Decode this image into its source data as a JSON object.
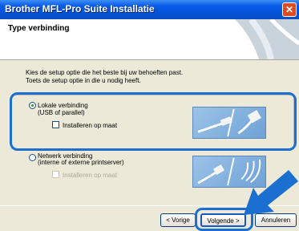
{
  "window": {
    "title": "Brother MFL-Pro Suite Installatie",
    "close_glyph": "✕"
  },
  "header": {
    "title": "Type verbinding"
  },
  "intro": {
    "line1": "Kies de setup optie die het beste bij uw behoeften past.",
    "line2": "Toets de setup optie in die u nodig heeft."
  },
  "options": [
    {
      "title": "Lokale verbinding",
      "subtitle": "(USB of parallel)",
      "checkbox_label": "Installeren op maat",
      "selected": true
    },
    {
      "title": "Netwerk verbinding",
      "subtitle": "(interne of externe printserver)",
      "checkbox_label": "Installeren op maat",
      "selected": false
    }
  ],
  "buttons": {
    "back": "< Vorige",
    "next": "Volgende >",
    "cancel": "Annuleren"
  },
  "colors": {
    "highlight": "#1a6fd0",
    "titlebar": "#0a5ce8"
  }
}
